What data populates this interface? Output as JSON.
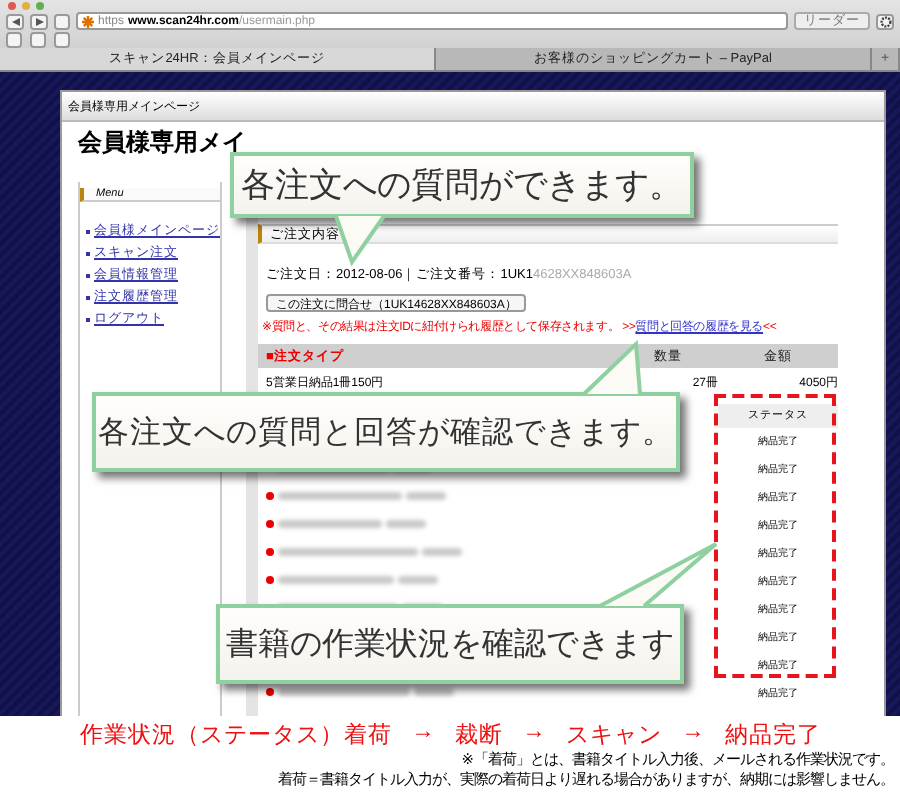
{
  "browser": {
    "url_scheme": "https",
    "url_host": "www.scan24hr.com",
    "url_path": "/usermain.php",
    "reader_button": "リーダー",
    "new_tab": "+",
    "tabs": [
      {
        "label": "スキャン24HR：会員メインページ",
        "selected": true
      },
      {
        "label": "お客様のショッピングカート – PayPal",
        "selected": false
      }
    ]
  },
  "page": {
    "header": "会員様専用メインページ",
    "title": "会員様専用メイ"
  },
  "menu": {
    "title": "Menu",
    "items": [
      "会員様メインページ",
      "スキャン注文",
      "会員情報管理",
      "注文履歴管理",
      "ログアウト"
    ]
  },
  "order": {
    "section_title": "ご注文内容",
    "summary": "ご注文日：2012-08-06｜ご注文番号：1UK1",
    "summary_faded": "4628XX848603A",
    "inquiry_button": "この注文に問合せ（1UK14628XX848603A）",
    "note": "※質問と、その結果は注文IDに紐付けられ履歴として保存されます。 >>",
    "history_link": "質問と回答の履歴を見る",
    "link_suffix": "<<",
    "columns": [
      "■注文タイプ",
      "数量",
      "金額"
    ],
    "row": {
      "type": "5営業日納品1冊150円",
      "quantity": "27冊",
      "amount": "4050円"
    },
    "status_header": "ステータス",
    "statuses": [
      "納品完了",
      "納品完了",
      "納品完了",
      "納品完了",
      "納品完了",
      "納品完了",
      "納品完了",
      "納品完了",
      "納品完了",
      "納品完了"
    ]
  },
  "callouts": [
    {
      "text": "各注文への質問ができます。"
    },
    {
      "text": "各注文への質問と回答が確認できます。"
    },
    {
      "text": "書籍の作業状況を確認できます"
    }
  ],
  "footer": {
    "flow": [
      "作業状況（ステータス）着荷",
      "→",
      "裁断",
      "→",
      "スキャン",
      "→",
      "納品完了"
    ],
    "notes": [
      "※「着荷」とは、書籍タイトル入力後、メールされる作業状況です。",
      "着荷＝書籍タイトル入力が、実際の着荷日より遅れる場合がありますが、納期には影響しません。"
    ]
  }
}
